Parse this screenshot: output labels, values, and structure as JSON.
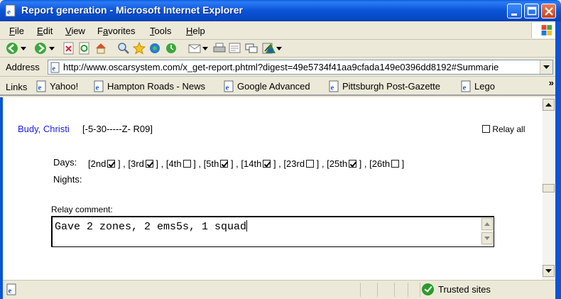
{
  "window": {
    "title": "Report generation - Microsoft Internet Explorer"
  },
  "menu": [
    {
      "label": "File",
      "accel": "F",
      "rest": "ile"
    },
    {
      "label": "Edit",
      "accel": "E",
      "rest": "dit"
    },
    {
      "label": "View",
      "accel": "V",
      "rest": "iew"
    },
    {
      "label": "Favorites",
      "accel": "a",
      "pre": "F",
      "rest": "vorites"
    },
    {
      "label": "Tools",
      "accel": "T",
      "rest": "ools"
    },
    {
      "label": "Help",
      "accel": "H",
      "rest": "elp"
    }
  ],
  "address": {
    "label": "Address",
    "url": "http://www.oscarsystem.com/x_get-report.phtml?digest=49e5734f41aa9cfada149e0396dd8192#Summarie"
  },
  "links": {
    "label": "Links",
    "items": [
      "Yahoo!",
      "Hampton Roads - News",
      "Google Advanced",
      "Pittsburgh Post-Gazette",
      "Lego"
    ],
    "more": "»"
  },
  "content": {
    "person_name": "Budy, Christi",
    "person_code": "[-5-30-----Z- R09]",
    "relay_all_label": "Relay all",
    "days_label": "Days:",
    "days": [
      {
        "label": "2nd",
        "checked": true
      },
      {
        "label": "3rd",
        "checked": true
      },
      {
        "label": "4th",
        "checked": false
      },
      {
        "label": "5th",
        "checked": true
      },
      {
        "label": "14th",
        "checked": true
      },
      {
        "label": "23rd",
        "checked": false
      },
      {
        "label": "25th",
        "checked": true
      },
      {
        "label": "26th",
        "checked": false
      }
    ],
    "nights_label": "Nights:",
    "relay_comment_label": "Relay comment:",
    "relay_comment_value": "Gave 2 zones, 2 ems5s, 1 squad"
  },
  "status": {
    "zone": "Trusted sites"
  },
  "colors": {
    "titlebar": "#0a54d8",
    "link": "#1a1aee",
    "trusted_icon": "#2c9a2c"
  }
}
